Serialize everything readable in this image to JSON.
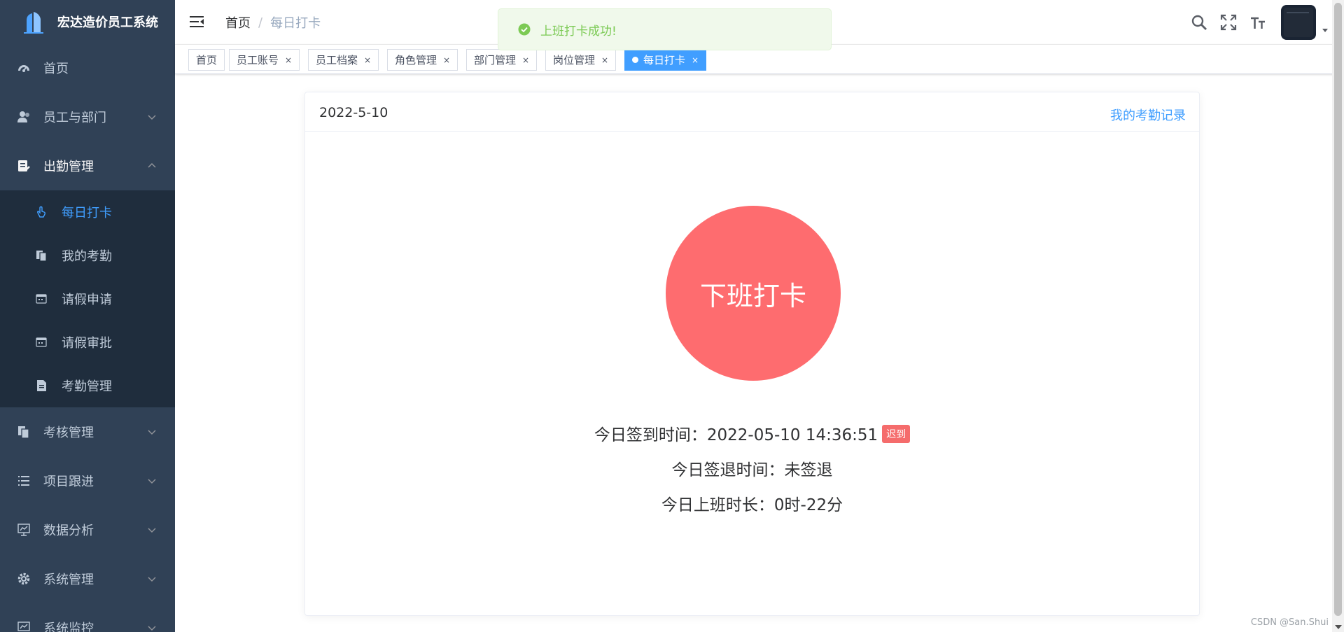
{
  "app": {
    "title": "宏达造价员工系统"
  },
  "sidebar": {
    "items": [
      {
        "label": "首页",
        "icon": "dashboard-icon"
      },
      {
        "label": "员工与部门",
        "icon": "peoples-icon"
      },
      {
        "label": "出勤管理",
        "icon": "attendance-icon"
      },
      {
        "label": "考核管理",
        "icon": "copy-icon"
      },
      {
        "label": "项目跟进",
        "icon": "list-icon"
      },
      {
        "label": "数据分析",
        "icon": "chart-icon"
      },
      {
        "label": "系统管理",
        "icon": "gear-icon"
      },
      {
        "label": "系统监控",
        "icon": "monitor-icon"
      }
    ],
    "attendance_sub": [
      {
        "label": "每日打卡",
        "icon": "hand-icon",
        "active": true
      },
      {
        "label": "我的考勤",
        "icon": "copy-icon"
      },
      {
        "label": "请假申请",
        "icon": "calendar-icon"
      },
      {
        "label": "请假审批",
        "icon": "calendar-icon"
      },
      {
        "label": "考勤管理",
        "icon": "document-icon"
      }
    ]
  },
  "breadcrumb": {
    "home": "首页",
    "separator": "/",
    "current": "每日打卡"
  },
  "tags": [
    {
      "label": "首页",
      "closable": false
    },
    {
      "label": "员工账号",
      "closable": true
    },
    {
      "label": "员工档案",
      "closable": true
    },
    {
      "label": "角色管理",
      "closable": true
    },
    {
      "label": "部门管理",
      "closable": true
    },
    {
      "label": "岗位管理",
      "closable": true
    },
    {
      "label": "每日打卡",
      "closable": true,
      "active": true
    }
  ],
  "tag_close_glyph": "×",
  "card": {
    "date": "2022-5-10",
    "link": "我的考勤记录",
    "punch_button": "下班打卡",
    "checkin_label": "今日签到时间：",
    "checkin_value": "2022-05-10 14:36:51",
    "late_badge": "迟到",
    "checkout_label": "今日签退时间：",
    "checkout_value": "未签退",
    "duration_label": "今日上班时长：",
    "duration_value": "0时-22分"
  },
  "toast": {
    "message": "上班打卡成功!",
    "type": "success"
  },
  "watermark": "CSDN @San.Shui",
  "colors": {
    "sidebar_bg": "#304156",
    "submenu_bg": "#1f2d3d",
    "accent": "#409eff",
    "punch": "#fe6c6f",
    "late": "#f56c6c",
    "success": "#67c23a"
  }
}
